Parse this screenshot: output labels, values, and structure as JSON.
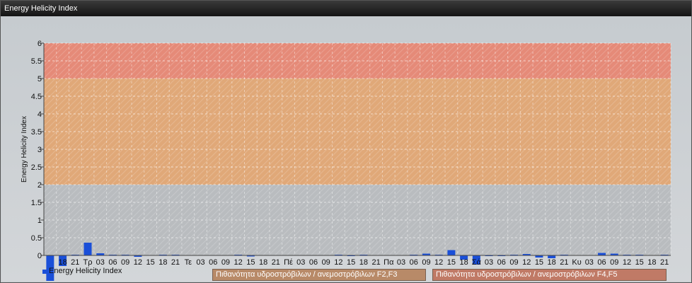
{
  "window": {
    "title": "Energy Helicity Index"
  },
  "colors": {
    "bar": "#1a4fd8",
    "zone_low": "#b9bcbf",
    "zone_mid": "#e0a878",
    "zone_high": "#e58a78",
    "grid": "#ffffff"
  },
  "legend": {
    "series_label": "Energy Helicity Index",
    "zone_low_label": "Πιθανότητα υδροστρόβιλων / ανεμοστρόβιλων F2,F3",
    "zone_high_label": "Πιθανότητα υδροστρόβιλων / ανεμοστρόβιλων F4,F5"
  },
  "chart_data": {
    "type": "bar",
    "title": "Energy Helicity Index",
    "ylabel": "Energy Helicity Index",
    "xlabel": "",
    "ylim": [
      0,
      6
    ],
    "yticks": [
      "0",
      "0.5",
      "1",
      "1.5",
      "2",
      "2.5",
      "3",
      "3.5",
      "4",
      "4.5",
      "5",
      "5.5",
      "6"
    ],
    "grid": true,
    "legend_position": "bottom-left",
    "zones": [
      {
        "from": 0,
        "to": 2,
        "label": ""
      },
      {
        "from": 2,
        "to": 5,
        "label": "Πιθανότητα υδροστρόβιλων / ανεμοστρόβιλων F2,F3"
      },
      {
        "from": 5,
        "to": 6,
        "label": "Πιθανότητα υδροστρόβιλων / ανεμοστρόβιλων F4,F5"
      }
    ],
    "categories": [
      "",
      "18",
      "21",
      "Τρ",
      "03",
      "06",
      "09",
      "12",
      "15",
      "18",
      "21",
      "Τε",
      "03",
      "06",
      "09",
      "12",
      "15",
      "18",
      "21",
      "Πέ",
      "03",
      "06",
      "09",
      "12",
      "15",
      "18",
      "21",
      "Πα",
      "03",
      "06",
      "09",
      "12",
      "15",
      "18",
      "Σά",
      "03",
      "06",
      "09",
      "12",
      "15",
      "18",
      "21",
      "Κυ",
      "03",
      "06",
      "09",
      "12",
      "15",
      "18",
      "21"
    ],
    "series": [
      {
        "name": "Energy Helicity Index",
        "values": [
          -0.72,
          -0.3,
          0.02,
          0.36,
          0.06,
          0.02,
          0.02,
          -0.04,
          0.01,
          0.02,
          0.02,
          0.01,
          0.01,
          0.01,
          0.01,
          0.02,
          -0.03,
          0.01,
          0.01,
          0.01,
          0.01,
          0.01,
          0.01,
          0.02,
          -0.02,
          0.02,
          0.01,
          0.01,
          0.01,
          0.02,
          0.05,
          0.02,
          0.15,
          -0.12,
          -0.26,
          -0.02,
          -0.01,
          0.02,
          0.04,
          -0.06,
          -0.08,
          0.02,
          0.01,
          0.01,
          0.07,
          0.05,
          0.02,
          0.02,
          0.01,
          0.02
        ]
      }
    ]
  }
}
